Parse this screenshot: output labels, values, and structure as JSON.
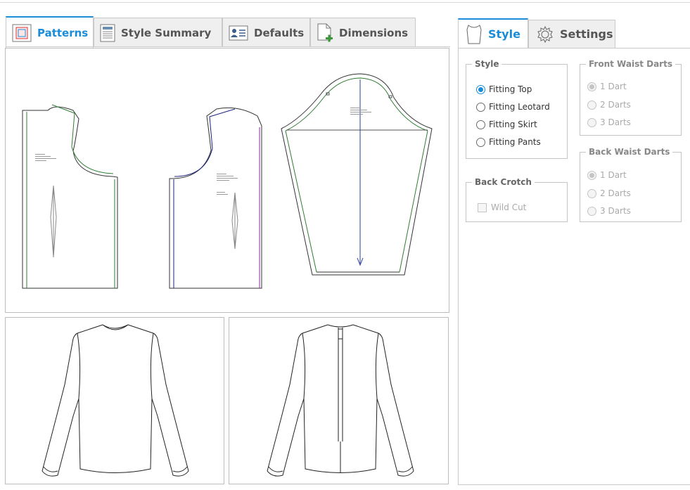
{
  "tabs_left": [
    {
      "label": "Patterns",
      "icon": "patterns-icon",
      "active": true
    },
    {
      "label": "Style Summary",
      "icon": "document-icon",
      "active": false
    },
    {
      "label": "Defaults",
      "icon": "profile-card-icon",
      "active": false
    },
    {
      "label": "Dimensions",
      "icon": "document-add-icon",
      "active": false
    }
  ],
  "tabs_right": [
    {
      "label": "Style",
      "icon": "garment-icon",
      "active": true
    },
    {
      "label": "Settings",
      "icon": "gear-icon",
      "active": false
    }
  ],
  "style_group": {
    "legend": "Style",
    "options": [
      {
        "label": "Fitting Top",
        "checked": true
      },
      {
        "label": "Fitting Leotard",
        "checked": false
      },
      {
        "label": "Fitting Skirt",
        "checked": false
      },
      {
        "label": "Fitting Pants",
        "checked": false
      }
    ]
  },
  "back_crotch": {
    "legend": "Back Crotch",
    "checkbox_label": "Wild Cut",
    "checked": false,
    "enabled": false
  },
  "front_waist_darts": {
    "legend": "Front Waist Darts",
    "enabled": false,
    "options": [
      {
        "label": "1 Dart",
        "checked": true
      },
      {
        "label": "2 Darts",
        "checked": false
      },
      {
        "label": "3 Darts",
        "checked": false
      }
    ]
  },
  "back_waist_darts": {
    "legend": "Back Waist Darts",
    "enabled": false,
    "options": [
      {
        "label": "1 Dart",
        "checked": true
      },
      {
        "label": "2 Darts",
        "checked": false
      },
      {
        "label": "3 Darts",
        "checked": false
      }
    ]
  },
  "colors": {
    "accent": "#1a8cd8",
    "pattern_green": "#2e7d32",
    "pattern_navy": "#1a237e"
  }
}
